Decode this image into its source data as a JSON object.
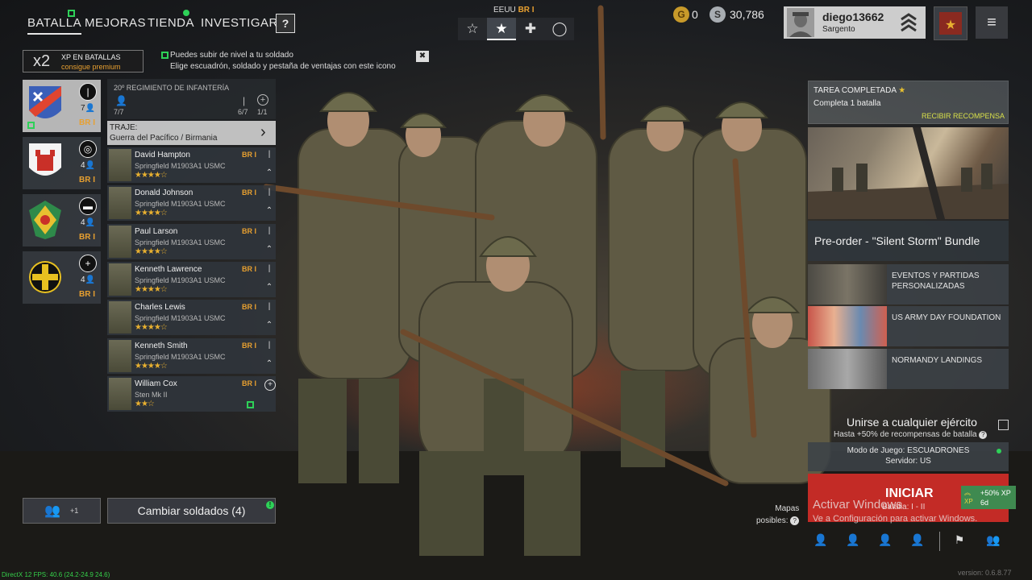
{
  "nav": {
    "tabs": [
      {
        "label": "BATALLA",
        "active": true
      },
      {
        "label": "MEJORAS"
      },
      {
        "label": "TIENDA"
      },
      {
        "label": "INVESTIGAR"
      }
    ],
    "help_label": "?"
  },
  "nation": {
    "label": "EEUU",
    "br": "BR I",
    "tabs": [
      {
        "icon": "star-outline-icon",
        "glyph": "☆"
      },
      {
        "icon": "usa-star-icon",
        "glyph": "★",
        "active": true
      },
      {
        "icon": "germany-cross-icon",
        "glyph": "✚"
      },
      {
        "icon": "japan-circle-icon",
        "glyph": "◯"
      }
    ]
  },
  "currency": {
    "gold": "0",
    "silver": "30,786"
  },
  "user": {
    "name": "diego13662",
    "rank": "Sargento"
  },
  "xp_banner": {
    "multiplier": "x2",
    "title": "XP EN BATALLAS",
    "cta": "consigue premium"
  },
  "hint": {
    "line1": "Puedes subir de nivel a tu soldado",
    "line2": "Elige escuadrón, soldado y pestaña de ventajas con este icono",
    "close": "✖"
  },
  "squads": [
    {
      "count": "7",
      "br": "BR I",
      "type_icon": "rifle-icon",
      "type_glyph": "|",
      "active": true
    },
    {
      "count": "4",
      "br": "BR I",
      "type_icon": "crosshair-icon",
      "type_glyph": "◎"
    },
    {
      "count": "4",
      "br": "BR I",
      "type_icon": "tank-icon",
      "type_glyph": "▬"
    },
    {
      "count": "4",
      "br": "BR I",
      "type_icon": "plus-circle-icon",
      "type_glyph": "+"
    }
  ],
  "squad_detail": {
    "title": "20º REGIMIENTO DE INFANTERÍA",
    "soldiers_count": "7/7",
    "rifle_count": "6/7",
    "extra_count": "1/1"
  },
  "outfit": {
    "label": "TRAJE:",
    "value": "Guerra del Pacífico / Birmania"
  },
  "soldiers": [
    {
      "name": "David Hampton",
      "weapon": "Springfield M1903A1 USMC",
      "stars": "★★★★☆",
      "br": "BR I"
    },
    {
      "name": "Donald Johnson",
      "weapon": "Springfield M1903A1 USMC",
      "stars": "★★★★☆",
      "br": "BR I"
    },
    {
      "name": "Paul Larson",
      "weapon": "Springfield M1903A1 USMC",
      "stars": "★★★★☆",
      "br": "BR I"
    },
    {
      "name": "Kenneth Lawrence",
      "weapon": "Springfield M1903A1 USMC",
      "stars": "★★★★☆",
      "br": "BR I"
    },
    {
      "name": "Charles Lewis",
      "weapon": "Springfield M1903A1 USMC",
      "stars": "★★★★☆",
      "br": "BR I"
    },
    {
      "name": "Kenneth Smith",
      "weapon": "Springfield M1903A1 USMC",
      "stars": "★★★★☆",
      "br": "BR I"
    },
    {
      "name": "William Cox",
      "weapon": "Sten Mk II",
      "stars": "★★☆",
      "br": "BR I"
    }
  ],
  "bottom_left": {
    "friends_label": "+1",
    "change_soldiers": "Cambiar soldados (4)"
  },
  "task": {
    "title": "TAREA COMPLETADA",
    "desc": "Completa 1 batalla",
    "reward": "RECIBIR RECOMPENSA"
  },
  "promo": {
    "title": "Pre-order - \"Silent Storm\" Bundle"
  },
  "events": [
    {
      "label1": "EVENTOS Y PARTIDAS",
      "label2": "PERSONALIZADAS"
    },
    {
      "label1": "US ARMY DAY FOUNDATION",
      "label2": ""
    },
    {
      "label1": "NORMANDY LANDINGS",
      "label2": ""
    }
  ],
  "join": {
    "title": "Unirse a cualquier ejército",
    "subtitle": "Hasta +50% de recompensas de batalla"
  },
  "mode": {
    "game_mode": "Modo de Juego: ESCUADRONES",
    "server": "Servidor: US"
  },
  "start": {
    "label": "INICIAR",
    "sub": "Batalla: I - II"
  },
  "xp_boost": {
    "value": "+50% XP",
    "time": "6d",
    "tag": "XP"
  },
  "maps": {
    "line1": "Mapas",
    "line2": "posibles:"
  },
  "watermark": {
    "title": "Activar Windows",
    "sub": "Ve a Configuración para activar Windows."
  },
  "fps": "DirectX 12 FPS: 40.6 (24.2-24.9 24.6)",
  "version": "version: 0.6.8.77",
  "colors": {
    "accent_green": "#2ed158",
    "br_orange": "#e8a030",
    "start_red": "#c32b26",
    "reward_yellow": "#d8e04a"
  }
}
